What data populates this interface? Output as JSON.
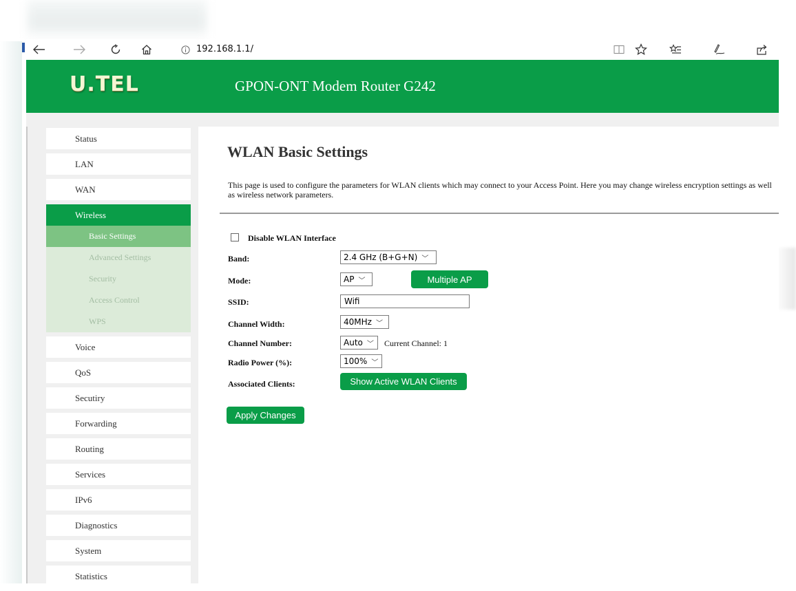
{
  "browser": {
    "url": "192.168.1.1/",
    "icons": [
      "back-icon",
      "forward-icon",
      "refresh-icon",
      "home-icon",
      "info-icon",
      "reading-view-icon",
      "favorite-star-icon",
      "favorites-list-icon",
      "pen-icon",
      "share-icon"
    ]
  },
  "header": {
    "logo": "U.TEL",
    "title": "GPON-ONT Modem Router G242",
    "accent": "#0a9d48"
  },
  "sidebar": {
    "items_before": [
      "Status",
      "LAN",
      "WAN"
    ],
    "active": "Wireless",
    "sub": [
      "Basic Settings",
      "Advanced Settings",
      "Security",
      "Access Control",
      "WPS"
    ],
    "items_after": [
      "Voice",
      "QoS",
      "Secutiry",
      "Forwarding",
      "Routing",
      "Services",
      "IPv6",
      "Diagnostics",
      "System",
      "Statistics"
    ]
  },
  "page": {
    "title": "WLAN Basic Settings",
    "description": "This page is used to configure the parameters for WLAN clients which may connect to your Access Point. Here you may change wireless encryption settings as well as wireless network parameters."
  },
  "form": {
    "disable_label": "Disable WLAN Interface",
    "band_label": "Band:",
    "band_value": "2.4 GHz (B+G+N)",
    "mode_label": "Mode:",
    "mode_value": "AP",
    "multiple_ap": "Multiple AP",
    "ssid_label": "SSID:",
    "ssid_value": "Wifi",
    "width_label": "Channel Width:",
    "width_value": "40MHz",
    "channel_label": "Channel Number:",
    "channel_value": "Auto",
    "current_channel": "Current Channel: 1",
    "power_label": "Radio Power (%):",
    "power_value": "100%",
    "clients_label": "Associated Clients:",
    "show_clients": "Show Active WLAN Clients",
    "apply": "Apply Changes"
  }
}
